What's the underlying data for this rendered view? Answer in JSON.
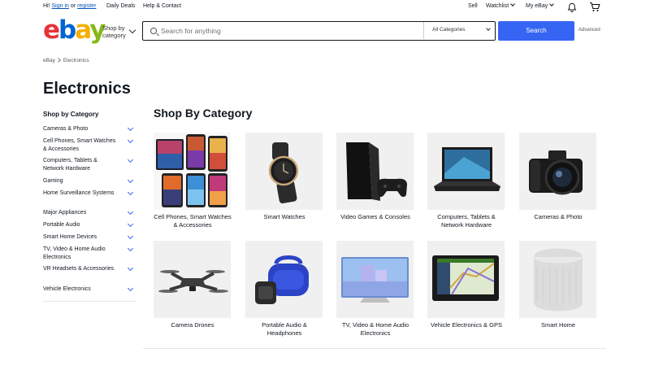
{
  "topbar": {
    "greeting": "Hi!",
    "sign_in": "Sign in",
    "or": "or",
    "register": "register",
    "daily_deals": "Daily Deals",
    "help": "Help & Contact",
    "sell": "Sell",
    "watchlist": "Watchlist",
    "my_ebay": "My eBay"
  },
  "header": {
    "logo": {
      "e": "e",
      "b": "b",
      "a": "a",
      "y": "y"
    },
    "shop_by_line1": "Shop by",
    "shop_by_line2": "category",
    "search_placeholder": "Search for anything",
    "category_selected": "All Categories",
    "search_button": "Search",
    "advanced": "Advanced"
  },
  "breadcrumb": {
    "root": "eBay",
    "current": "Electronics"
  },
  "page_title": "Electronics",
  "sidebar": {
    "heading": "Shop by Category",
    "items": [
      {
        "label": "Cameras & Photo"
      },
      {
        "label": "Cell Phones, Smart Watches & Accessories"
      },
      {
        "label": "Computers, Tablets & Network Hardware"
      },
      {
        "label": "Gaming"
      },
      {
        "label": "Home Surveillance Systems"
      },
      {
        "label": "Major Appliances"
      },
      {
        "label": "Portable Audio"
      },
      {
        "label": "Smart Home Devices"
      },
      {
        "label": "TV, Video & Home Audio Electronics"
      },
      {
        "label": "VR Headsets & Accessories"
      },
      {
        "label": "Vehicle Electronics"
      }
    ]
  },
  "main": {
    "section_title": "Shop By Category",
    "categories": [
      {
        "label": "Cell Phones, Smart Watches & Accessories",
        "icon": "phones-icon"
      },
      {
        "label": "Smart Watches",
        "icon": "smartwatch-icon"
      },
      {
        "label": "Video Games & Consoles",
        "icon": "console-icon"
      },
      {
        "label": "Computers, Tablets & Network Hardware",
        "icon": "laptop-icon"
      },
      {
        "label": "Cameras & Photo",
        "icon": "camera-icon"
      },
      {
        "label": "Camera Drones",
        "icon": "drone-icon"
      },
      {
        "label": "Portable Audio & Headphones",
        "icon": "speaker-icon"
      },
      {
        "label": "TV, Video & Home Audio Electronics",
        "icon": "tv-icon"
      },
      {
        "label": "Vehicle Electronics & GPS",
        "icon": "gps-icon"
      },
      {
        "label": "Smart Home",
        "icon": "smart-speaker-icon"
      }
    ]
  },
  "colors": {
    "accent": "#3665f3",
    "link": "#0654ba",
    "logo_red": "#e53238",
    "logo_blue": "#0064d2",
    "logo_yellow": "#f5af02",
    "logo_green": "#86b817"
  }
}
